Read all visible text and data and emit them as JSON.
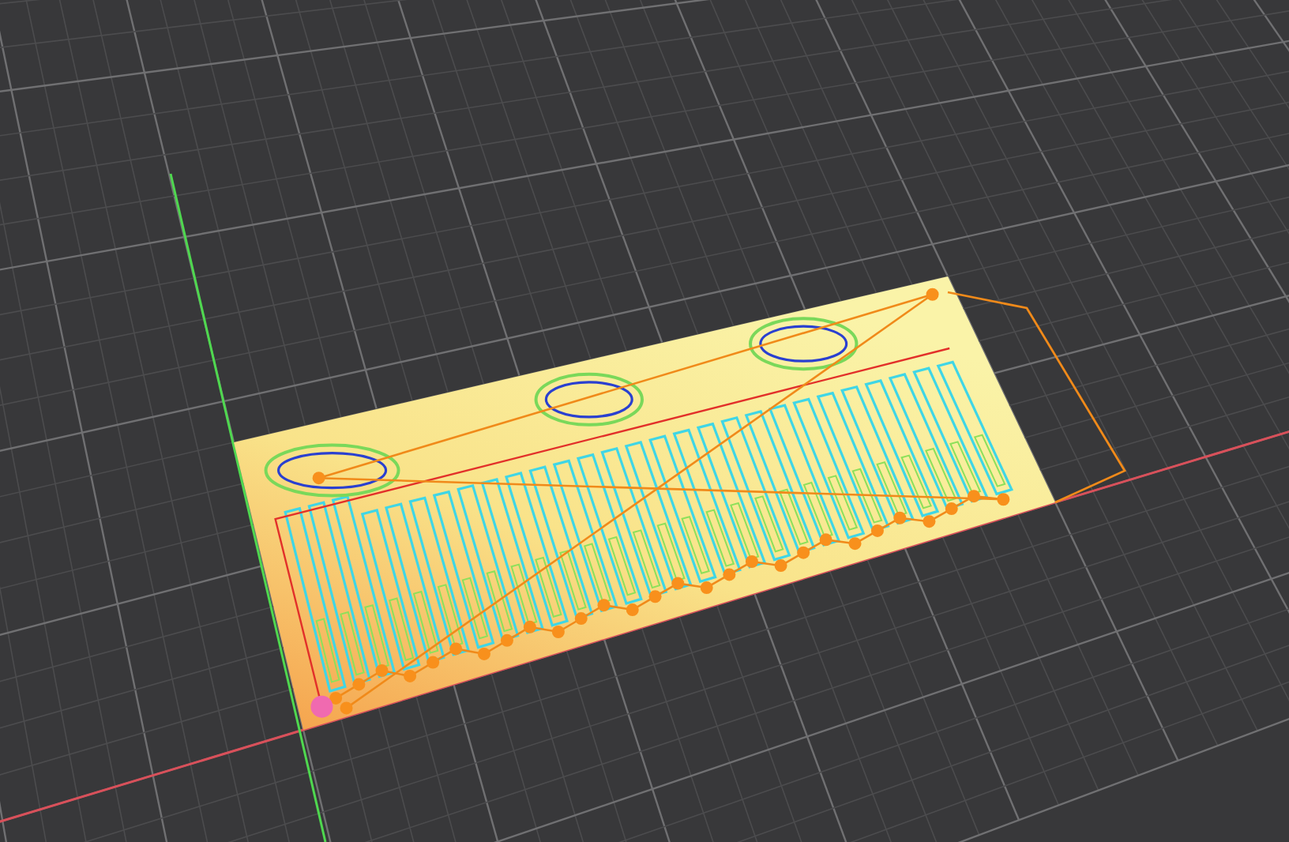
{
  "viewport": {
    "grid": true,
    "axes": true,
    "toolpath": true
  }
}
